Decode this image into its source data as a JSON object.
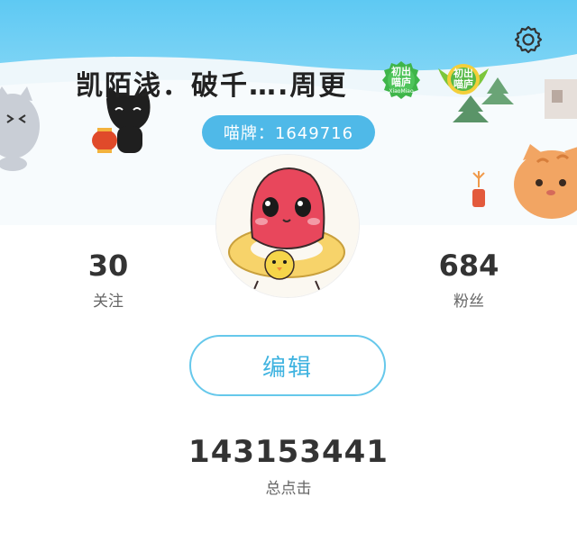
{
  "profile": {
    "username": "凯陌浅．破千….周更",
    "uid_text": "喵牌：1649716",
    "badges": [
      {
        "text_top": "初出",
        "text_bottom": "喵庐",
        "sub": "XiaoMiao"
      },
      {
        "text_top": "初出",
        "text_bottom": "喵庐"
      }
    ]
  },
  "stats": {
    "following": {
      "value": "30",
      "label": "关注"
    },
    "followers": {
      "value": "684",
      "label": "粉丝"
    }
  },
  "actions": {
    "edit_label": "编辑"
  },
  "total_clicks": {
    "value": "143153441",
    "label": "总点击"
  },
  "icons": {
    "settings": "gear-icon"
  },
  "colors": {
    "sky": "#5ec9f3",
    "accent": "#4fb9e8",
    "badge_green": "#3fb54a"
  }
}
